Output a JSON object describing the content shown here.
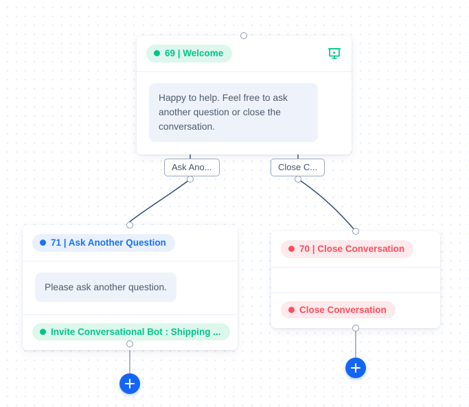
{
  "canvas": {
    "background_color": "#ffffff",
    "dot_color": "#e3edfb"
  },
  "colors": {
    "green": "#00c48c",
    "green_bg": "#ddf7ec",
    "blue": "#1a73f0",
    "blue_bg": "#e9f1ff",
    "red": "#ff4d5a",
    "red_bg": "#fdeaec",
    "bubble_bg": "#eef3fb",
    "bubble_text": "#4d5a6d",
    "edge_stroke": "#2d4a73",
    "add_button": "#1565f5"
  },
  "nodes": {
    "welcome": {
      "badge_label": "69 | Welcome",
      "icon_name": "presentation-play-icon",
      "message": "Happy to help. Feel free to ask another question or close the conversation."
    },
    "ask_another": {
      "badge_label": "71 | Ask Another Question",
      "message": "Please ask another question.",
      "action_label": "Invite Conversational Bot : Shipping ..."
    },
    "close_conversation": {
      "badge_label": "70 | Close Conversation",
      "action_label": "Close Conversation"
    }
  },
  "edges": {
    "ask_another_label": "Ask Ano...",
    "close_label": "Close C..."
  },
  "buttons": {
    "add_left_label": "+",
    "add_right_label": "+"
  }
}
